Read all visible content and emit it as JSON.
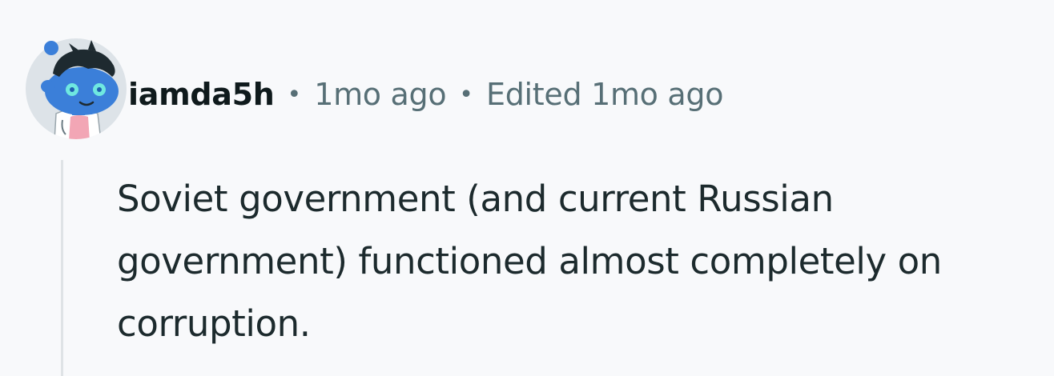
{
  "comment": {
    "username": "iamda5h",
    "separator": "•",
    "posted": "1mo ago",
    "edited": "Edited 1mo ago",
    "body": "Soviet government (and current Russian government) functioned almost completely on corruption."
  },
  "avatar": {
    "icon": "snoo-avatar-icon",
    "colors": {
      "background": "#dde3e8",
      "head": "#3b7fd9",
      "eyes": "#6fe8e0",
      "hair": "#1e2a30",
      "shirt": "#f2a6b5",
      "coat": "#ffffff"
    }
  }
}
